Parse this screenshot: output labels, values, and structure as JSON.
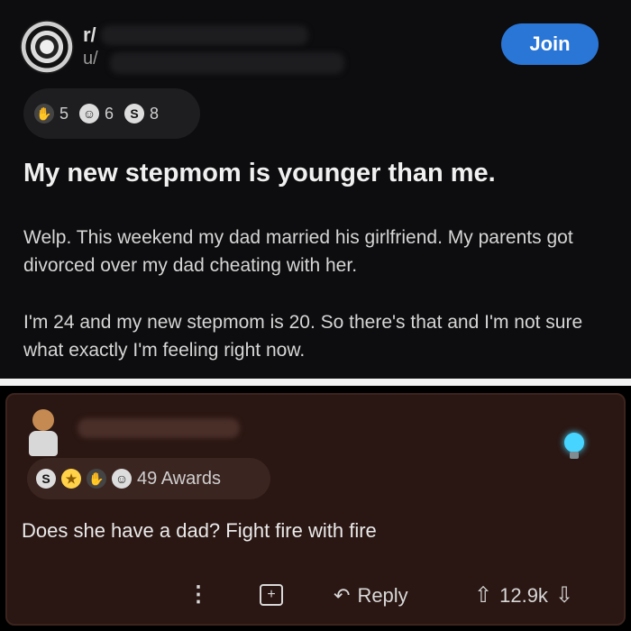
{
  "post": {
    "subreddit": "r/",
    "user": "u/",
    "join_label": "Join",
    "awards": [
      {
        "icon": "helpful-award-icon",
        "count": "5",
        "color": "#c7c7c7"
      },
      {
        "icon": "wholesome-award-icon",
        "count": "6",
        "color": "#d6d6d6"
      },
      {
        "icon": "silver-award-icon",
        "count": "8",
        "color": "#d0d0d0"
      }
    ],
    "title": "My new stepmom is younger than me.",
    "body_1": "Welp. This weekend my dad married his girlfriend. My parents got divorced over my dad cheating with her.",
    "body_2": "I'm 24 and my new stepmom is 20. So there's that and I'm not sure what exactly I'm feeling right now."
  },
  "comment": {
    "awards_label": "49 Awards",
    "text": "Does she have a dad? Fight fire with fire",
    "reply_label": "Reply",
    "vote_count": "12.9k"
  },
  "colors": {
    "join": "#2a76d6",
    "comment_bg": "#2a1612",
    "lightbulb": "#47d4ff"
  }
}
